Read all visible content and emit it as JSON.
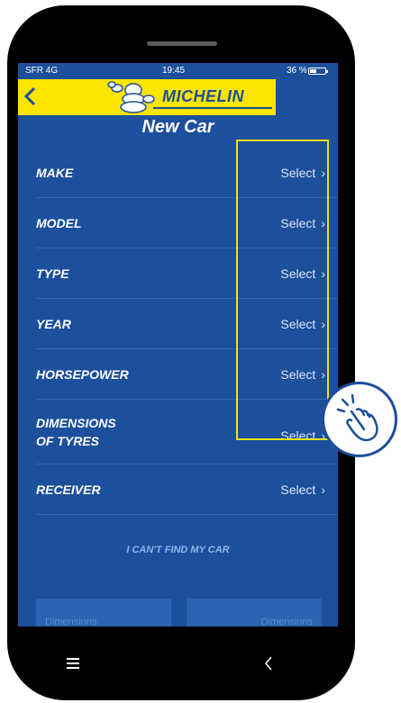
{
  "status_bar": {
    "carrier": "SFR 4G",
    "time": "19:45",
    "battery": "36 %"
  },
  "header": {
    "brand": "MICHELIN",
    "title": "New Car"
  },
  "rows": [
    {
      "label": "MAKE",
      "value": "Select"
    },
    {
      "label": "MODEL",
      "value": "Select"
    },
    {
      "label": "TYPE",
      "value": "Select"
    },
    {
      "label": "YEAR",
      "value": "Select"
    },
    {
      "label": "HORSEPOWER",
      "value": "Select"
    },
    {
      "label_line1": "DIMENSIONS",
      "label_line2": "OF TYRES",
      "value": "Select"
    },
    {
      "label": "RECEIVER",
      "value": "Select"
    }
  ],
  "link_cant_find": "I CAN'T FIND MY CAR",
  "bottom_tabs": [
    "Dimensions",
    "Dimensions"
  ],
  "colors": {
    "background": "#1c4f9c",
    "brand_yellow": "#fce500",
    "highlight": "#f0e20c"
  },
  "icons": {
    "back": "chevron-left-icon",
    "tap": "tap-hand-icon",
    "menu": "hamburger-icon",
    "nav_back": "chevron-left-icon"
  }
}
